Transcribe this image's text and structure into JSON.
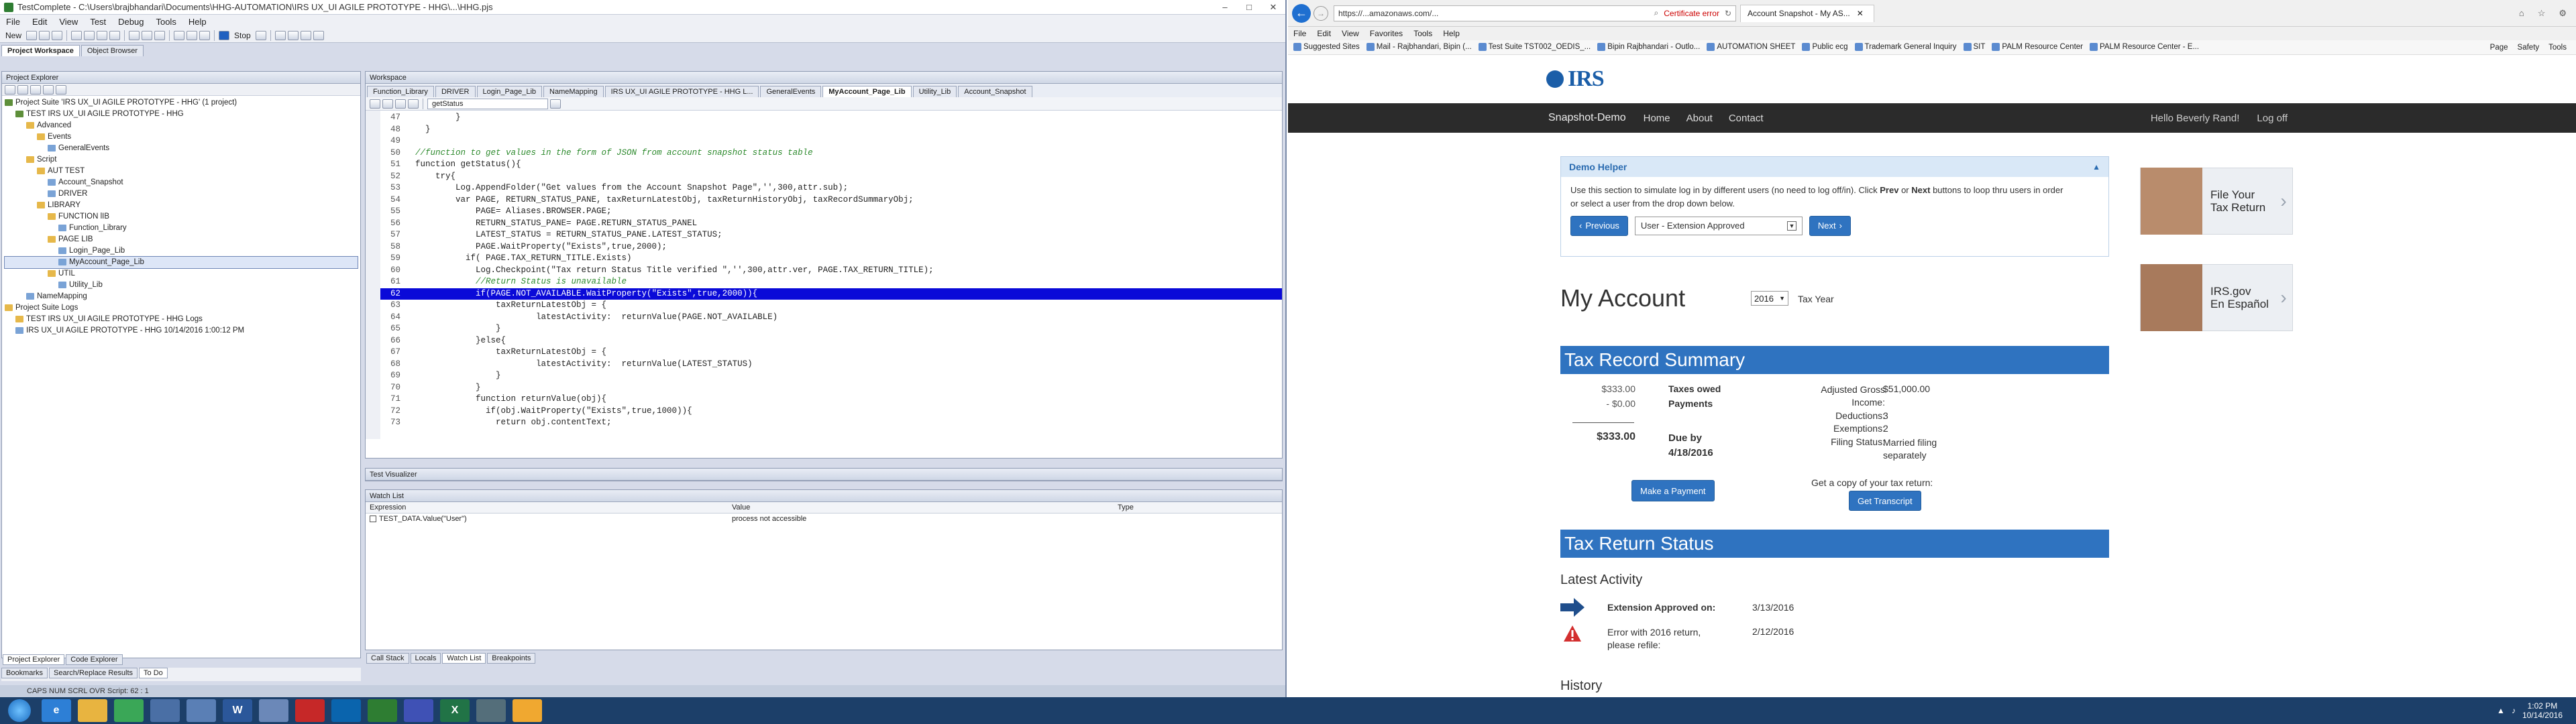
{
  "tc": {
    "title": "TestComplete - C:\\Users\\brajbhandari\\Documents\\HHG-AUTOMATION\\IRS UX_UI AGILE PROTOTYPE - HHG\\...\\HHG.pjs",
    "menu": [
      "File",
      "Edit",
      "View",
      "Test",
      "Debug",
      "Tools",
      "Help"
    ],
    "toolbar_new": "New",
    "toolbar_stop": "Stop",
    "panel_tabs": [
      "Project Workspace",
      "Object Browser"
    ],
    "explorer_title": "Project Explorer",
    "tree": [
      {
        "label": "Project Suite 'IRS UX_UI AGILE PROTOTYPE - HHG' (1 project)",
        "depth": 0,
        "type": "proj"
      },
      {
        "label": "TEST IRS UX_UI AGILE PROTOTYPE - HHG",
        "depth": 1,
        "type": "proj"
      },
      {
        "label": "Advanced",
        "depth": 2,
        "type": "folder"
      },
      {
        "label": "Events",
        "depth": 3,
        "type": "folder"
      },
      {
        "label": "GeneralEvents",
        "depth": 4,
        "type": "file"
      },
      {
        "label": "Script",
        "depth": 2,
        "type": "folder"
      },
      {
        "label": "AUT TEST",
        "depth": 3,
        "type": "folder"
      },
      {
        "label": "Account_Snapshot",
        "depth": 4,
        "type": "file"
      },
      {
        "label": "DRIVER",
        "depth": 4,
        "type": "file"
      },
      {
        "label": "LIBRARY",
        "depth": 3,
        "type": "folder"
      },
      {
        "label": "FUNCTION lIB",
        "depth": 4,
        "type": "folder"
      },
      {
        "label": "Function_Library",
        "depth": 5,
        "type": "file"
      },
      {
        "label": "PAGE LIB",
        "depth": 4,
        "type": "folder"
      },
      {
        "label": "Login_Page_Lib",
        "depth": 5,
        "type": "file"
      },
      {
        "label": "MyAccount_Page_Lib",
        "depth": 5,
        "type": "file",
        "selected": true
      },
      {
        "label": "UTIL",
        "depth": 4,
        "type": "folder"
      },
      {
        "label": "Utility_Lib",
        "depth": 5,
        "type": "file"
      },
      {
        "label": "NameMapping",
        "depth": 2,
        "type": "file"
      },
      {
        "label": "Project Suite Logs",
        "depth": 0,
        "type": "folder"
      },
      {
        "label": "TEST IRS UX_UI AGILE PROTOTYPE - HHG Logs",
        "depth": 1,
        "type": "folder"
      },
      {
        "label": "IRS UX_UI AGILE PROTOTYPE - HHG 10/14/2016 1:00:12 PM",
        "depth": 1,
        "type": "file"
      }
    ],
    "explorer_bottom_tabs": [
      "Project Explorer",
      "Code Explorer"
    ],
    "bottom_left_tabs": [
      "Bookmarks",
      "Search/Replace Results",
      "To Do"
    ],
    "workspace_title": "Workspace",
    "editor_tabs": [
      "Function_Library",
      "DRIVER",
      "Login_Page_Lib",
      "NameMapping",
      "IRS UX_UI AGILE PROTOTYPE - HHG L...",
      "GeneralEvents",
      "MyAccount_Page_Lib",
      "Utility_Lib",
      "Account_Snapshot"
    ],
    "function_combo": "getStatus",
    "code_lines": [
      {
        "n": "47",
        "t": "        }",
        "c": ""
      },
      {
        "n": "48",
        "t": "  }",
        "c": ""
      },
      {
        "n": "49",
        "t": "",
        "c": ""
      },
      {
        "n": "50",
        "t": "//function to get values in the form of JSON from account snapshot status table",
        "c": "cm"
      },
      {
        "n": "51",
        "t": "function getStatus(){",
        "c": ""
      },
      {
        "n": "52",
        "t": "    try{",
        "c": ""
      },
      {
        "n": "53",
        "t": "        Log.AppendFolder(\"Get values from the Account Snapshot Page\",'',300,attr.sub);",
        "c": ""
      },
      {
        "n": "54",
        "t": "        var PAGE, RETURN_STATUS_PANE, taxReturnLatestObj, taxReturnHistoryObj, taxRecordSummaryObj;",
        "c": ""
      },
      {
        "n": "55",
        "t": "            PAGE= Aliases.BROWSER.PAGE;",
        "c": ""
      },
      {
        "n": "56",
        "t": "            RETURN_STATUS_PANE= PAGE.RETURN_STATUS_PANEL",
        "c": ""
      },
      {
        "n": "57",
        "t": "            LATEST_STATUS = RETURN_STATUS_PANE.LATEST_STATUS;",
        "c": ""
      },
      {
        "n": "58",
        "t": "            PAGE.WaitProperty(\"Exists\",true,2000);",
        "c": ""
      },
      {
        "n": "59",
        "t": "          if( PAGE.TAX_RETURN_TITLE.Exists)",
        "c": ""
      },
      {
        "n": "60",
        "t": "            Log.Checkpoint(\"Tax return Status Title verified \",'',300,attr.ver, PAGE.TAX_RETURN_TITLE);",
        "c": ""
      },
      {
        "n": "61",
        "t": "            //Return Status is unavailable",
        "c": "cm"
      },
      {
        "n": "62",
        "t": "            if(PAGE.NOT_AVAILABLE.WaitProperty(\"Exists\",true,2000)){",
        "c": "bp"
      },
      {
        "n": "63",
        "t": "                taxReturnLatestObj = {",
        "c": ""
      },
      {
        "n": "64",
        "t": "                        latestActivity:  returnValue(PAGE.NOT_AVAILABLE)",
        "c": ""
      },
      {
        "n": "65",
        "t": "                }",
        "c": ""
      },
      {
        "n": "66",
        "t": "            }else{",
        "c": ""
      },
      {
        "n": "67",
        "t": "                taxReturnLatestObj = {",
        "c": ""
      },
      {
        "n": "68",
        "t": "                        latestActivity:  returnValue(LATEST_STATUS)",
        "c": ""
      },
      {
        "n": "69",
        "t": "                }",
        "c": ""
      },
      {
        "n": "70",
        "t": "            }",
        "c": ""
      },
      {
        "n": "71",
        "t": "            function returnValue(obj){",
        "c": ""
      },
      {
        "n": "72",
        "t": "              if(obj.WaitProperty(\"Exists\",true,1000)){",
        "c": ""
      },
      {
        "n": "73",
        "t": "                return obj.contentText;",
        "c": ""
      }
    ],
    "test_visualizer": "Test Visualizer",
    "watch_title": "Watch List",
    "watch_headers": [
      "Expression",
      "Value",
      "Type"
    ],
    "watch_rows": [
      {
        "expr": "TEST_DATA.Value(\"User\")",
        "value": "process not accessible",
        "type": ""
      }
    ],
    "watch_tabs": [
      "Call Stack",
      "Locals",
      "Watch List",
      "Breakpoints"
    ],
    "status": "CAPS  NUM  SCRL  OVR   Script: 62 : 1"
  },
  "ie": {
    "url": "https://...amazonaws.com/...",
    "cert_error": "Certificate error",
    "tab_title": "Account Snapshot - My AS...",
    "menu": [
      "File",
      "Edit",
      "View",
      "Favorites",
      "Tools",
      "Help"
    ],
    "favorites": [
      "Suggested Sites",
      "Mail - Rajbhandari, Bipin (...",
      "Test Suite TST002_OEDIS_...",
      "Bipin Rajbhandari - Outlo...",
      "AUTOMATION SHEET",
      "Public ecg",
      "Trademark General Inquiry",
      "SIT",
      "PALM Resource Center",
      "PALM Resource Center - E..."
    ],
    "cmdbar": [
      "Page",
      "Safety",
      "Tools"
    ],
    "irs_logo": "IRS",
    "nav": {
      "brand": "Snapshot-Demo",
      "links": [
        "Home",
        "About",
        "Contact"
      ],
      "hello": "Hello Beverly Rand!",
      "logoff": "Log off"
    },
    "demo": {
      "title": "Demo Helper",
      "text_a": "Use this section to simulate log in by different users (no need to log off/in). Click ",
      "prev_word": "Prev",
      "text_b": " or ",
      "next_word": "Next",
      "text_c": " buttons to loop thru users in order",
      "text_d": "or select a user from the drop down below.",
      "prev_btn": "Previous",
      "select": "User - Extension Approved",
      "next_btn": "Next"
    },
    "promo1": {
      "line1": "File Your",
      "line2": "Tax Return"
    },
    "promo2": {
      "line1": "IRS.gov",
      "line2": "En Español"
    },
    "my_account": "My Account",
    "year": "2016",
    "tax_year_label": "Tax Year",
    "summary_title": "Tax Record Summary",
    "taxes_owed_amt": "$333.00",
    "taxes_owed_lbl": "Taxes owed",
    "payments_amt": "- $0.00",
    "payments_lbl": "Payments",
    "total_amt": "$333.00",
    "due_lbl": "Due by",
    "due_date": "4/18/2016",
    "make_payment": "Make a Payment",
    "agi_lbl": "Adjusted Gross",
    "agi_lbl2": "Income:",
    "agi_val": "$51,000.00",
    "ded_lbl": "Deductions:",
    "ded_val": "3",
    "ex_lbl": "Exemptions:",
    "ex_val": "2",
    "fs_lbl": "Filing Status:",
    "fs_val1": "Married filing",
    "fs_val2": "separately",
    "transcript_q": "Get a copy of your tax return:",
    "transcript_btn": "Get Transcript",
    "status_title": "Tax Return Status",
    "latest_activity": "Latest Activity",
    "act1_lbl": "Extension Approved on:",
    "act1_date": "3/13/2016",
    "act2_lbl1": "Error with 2016 return,",
    "act2_lbl2": "please refile:",
    "act2_date": "2/12/2016",
    "history": "History"
  },
  "taskbar": {
    "time": "1:02 PM",
    "date": "10/14/2016"
  },
  "colors": {
    "irs_blue": "#2f73c0",
    "nav_dark": "#2b2b2b",
    "tc_bg": "#d6dbe9"
  }
}
